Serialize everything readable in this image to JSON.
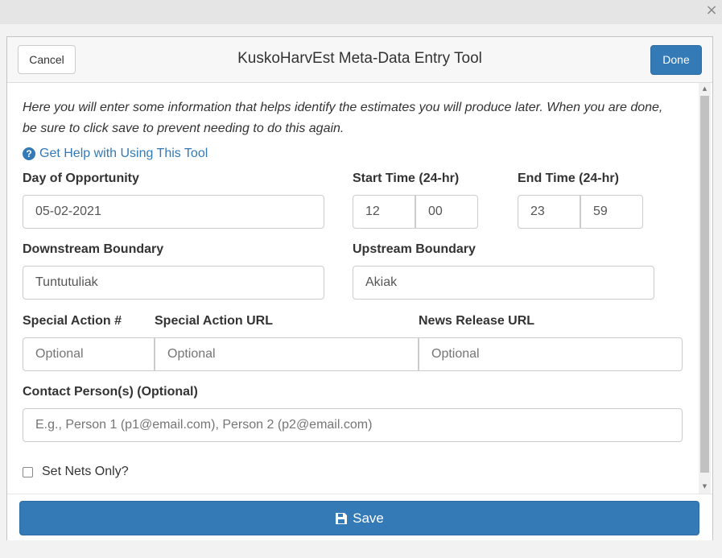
{
  "window": {
    "close_glyph": "×"
  },
  "header": {
    "cancel_label": "Cancel",
    "title": "KuskoHarvEst Meta-Data Entry Tool",
    "done_label": "Done"
  },
  "intro": "Here you will enter some information that helps identify the estimates you will produce later. When you are done, be sure to click save to prevent needing to do this again.",
  "help": {
    "icon": "question-circle-icon",
    "label": "Get Help with Using This Tool"
  },
  "fields": {
    "day_of_opportunity": {
      "label": "Day of Opportunity",
      "value": "05-02-2021"
    },
    "start_time": {
      "label": "Start Time (24-hr)",
      "hour": "12",
      "minute": "00"
    },
    "end_time": {
      "label": "End Time (24-hr)",
      "hour": "23",
      "minute": "59"
    },
    "downstream": {
      "label": "Downstream Boundary",
      "value": "Tuntutuliak"
    },
    "upstream": {
      "label": "Upstream Boundary",
      "value": "Akiak"
    },
    "special_action_num": {
      "label": "Special Action #",
      "placeholder": "Optional"
    },
    "special_action_url": {
      "label": "Special Action URL",
      "placeholder": "Optional"
    },
    "news_release_url": {
      "label": "News Release URL",
      "placeholder": "Optional"
    },
    "contact": {
      "label": "Contact Person(s) (Optional)",
      "placeholder": "E.g., Person 1 (p1@email.com), Person 2 (p2@email.com)"
    }
  },
  "set_nets_only": {
    "label": "Set Nets Only?",
    "checked": false
  },
  "footer": {
    "save_label": "Save",
    "save_icon": "floppy-disk-icon"
  },
  "colors": {
    "primary": "#337ab7",
    "primary_border": "#2e6da4"
  }
}
